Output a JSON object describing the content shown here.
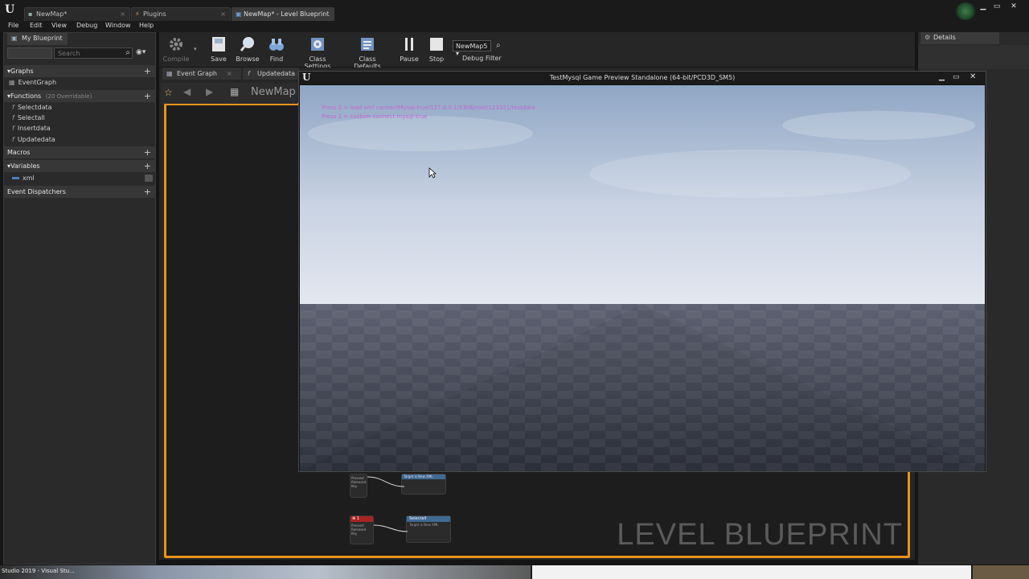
{
  "tabs": [
    {
      "label": "NewMap*",
      "active": false
    },
    {
      "label": "Plugins",
      "active": false
    },
    {
      "label": "NewMap* - Level Blueprint",
      "active": true
    }
  ],
  "menu": [
    "File",
    "Edit",
    "View",
    "Debug",
    "Window",
    "Help"
  ],
  "left_panel": {
    "tab_label": "My Blueprint",
    "search_placeholder": "Search",
    "graphs": {
      "header": "Graphs",
      "items": [
        "EventGraph"
      ]
    },
    "functions": {
      "header": "Functions",
      "count_note": "(20 Overridable)",
      "items": [
        "Selectdata",
        "Selectall",
        "Insertdata",
        "Updatedata"
      ]
    },
    "macros": {
      "header": "Macros"
    },
    "variables": {
      "header": "Variables",
      "items": [
        "xml"
      ]
    },
    "dispatchers": {
      "header": "Event Dispatchers"
    }
  },
  "toolbar": {
    "compile": "Compile",
    "save": "Save",
    "browse": "Browse",
    "find": "Find",
    "class_settings": "Class Settings",
    "class_defaults": "Class Defaults",
    "pause": "Pause",
    "stop": "Stop",
    "debug_object": "NewMap5",
    "debug_filter": "Debug Filter"
  },
  "graph_tabs": [
    "Event Graph",
    "Updatedata"
  ],
  "breadcrumb": "NewMap",
  "watermark": "LEVEL BLUEPRINT",
  "details_tab": "Details",
  "game_window": {
    "title": "TestMysql Game Preview Standalone (64-bit/PCD3D_SM5)",
    "messages": [
      "Press 2 = load xml connectMysql-true/127.0.0.1/3306/root/123321/testdata",
      "Press 1 = custom connect mysql-true"
    ],
    "message_color": "#c266d6"
  },
  "nodes": [
    {
      "title": "Target is New XML",
      "pins": [
        "Pressed",
        "Released",
        "Key"
      ]
    },
    {
      "title": "Selectall",
      "subtitle": "Target is New XML",
      "event_label": "1",
      "pins": [
        "Pressed",
        "Released",
        "Key"
      ]
    }
  ],
  "taskbar": {
    "left_label": "Studio 2019 - Visual Stu..."
  },
  "colors": {
    "accent_border": "#e8931a",
    "panel": "#2a2a2a"
  }
}
